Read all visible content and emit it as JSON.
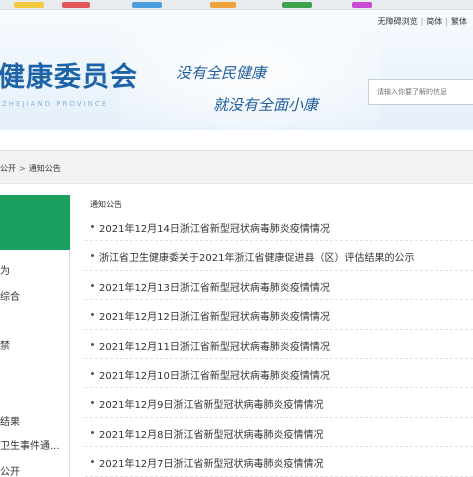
{
  "header": {
    "toplinks": [
      "无障碍浏览",
      "简体",
      "繁体"
    ],
    "site_title": "健康委员会",
    "site_subtitle": "ZHEJIANG PROVINCE",
    "slogan_line1": "没有全民健康",
    "slogan_line2": "就没有全面小康",
    "search": {
      "placeholder": "请输入你要了解的信息"
    }
  },
  "breadcrumb": {
    "items": [
      "公开",
      "通知公告"
    ],
    "separator": ">"
  },
  "sidebar": {
    "items": [
      "为",
      "综合",
      "禁",
      "结果",
      "卫生事件通...",
      "公开"
    ]
  },
  "main": {
    "panel_title": "通知公告",
    "news": [
      "2021年12月14日浙江省新型冠状病毒肺炎疫情情况",
      "浙江省卫生健康委关于2021年浙江省健康促进县（区）评估结果的公示",
      "2021年12月13日浙江省新型冠状病毒肺炎疫情情况",
      "2021年12月12日浙江省新型冠状病毒肺炎疫情情况",
      "2021年12月11日浙江省新型冠状病毒肺炎疫情情况",
      "2021年12月10日浙江省新型冠状病毒肺炎疫情情况",
      "2021年12月9日浙江省新型冠状病毒肺炎疫情情况",
      "2021年12月8日浙江省新型冠状病毒肺炎疫情情况",
      "2021年12月7日浙江省新型冠状病毒肺炎疫情情况"
    ]
  },
  "colors": {
    "brand_blue": "#1d63a8",
    "sidebar_green": "#1aa05f"
  }
}
